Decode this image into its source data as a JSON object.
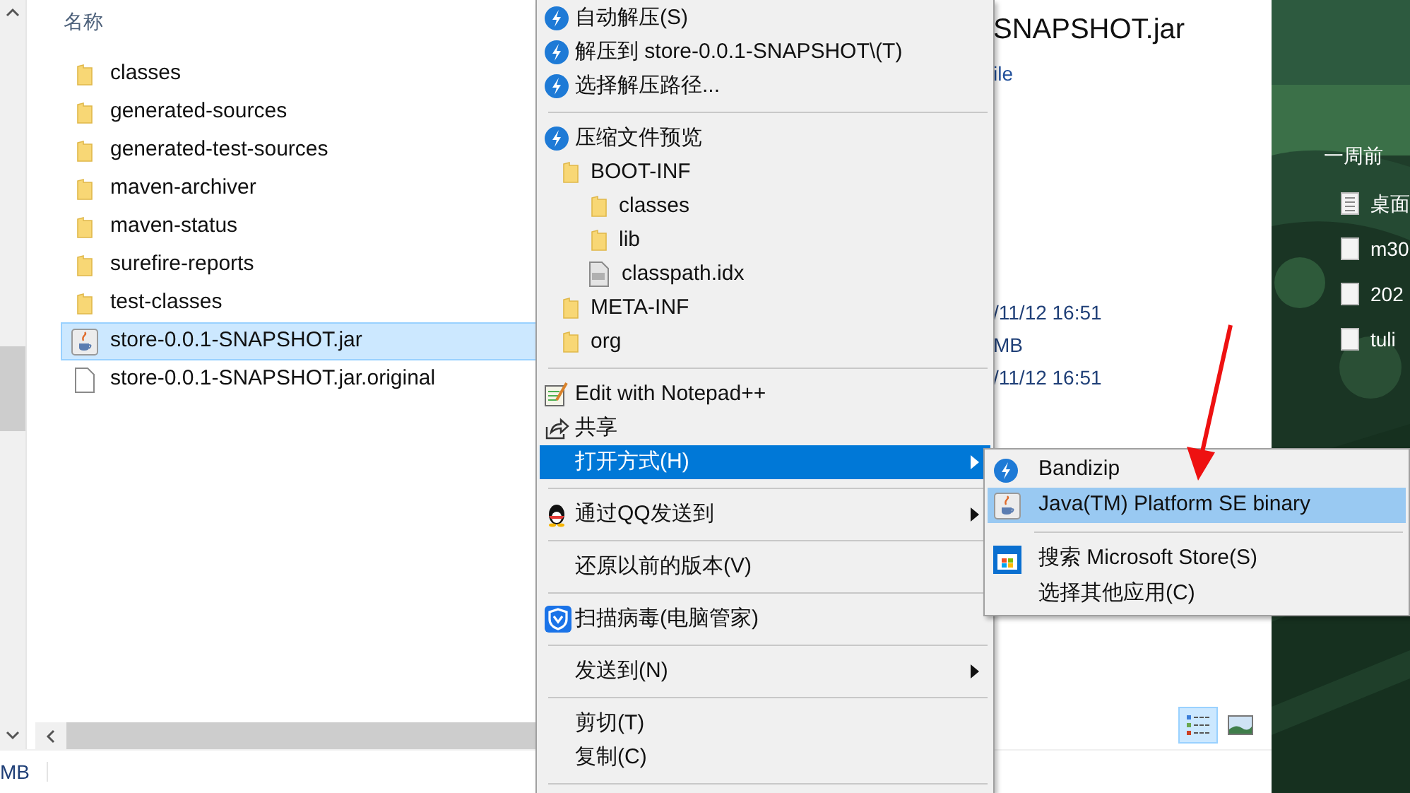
{
  "explorer": {
    "column_header": "名称",
    "files": [
      {
        "name": "classes",
        "kind": "folder",
        "selected": false
      },
      {
        "name": "generated-sources",
        "kind": "folder",
        "selected": false
      },
      {
        "name": "generated-test-sources",
        "kind": "folder",
        "selected": false
      },
      {
        "name": "maven-archiver",
        "kind": "folder",
        "selected": false
      },
      {
        "name": "maven-status",
        "kind": "folder",
        "selected": false
      },
      {
        "name": "surefire-reports",
        "kind": "folder",
        "selected": false
      },
      {
        "name": "test-classes",
        "kind": "folder",
        "selected": false
      },
      {
        "name": "store-0.0.1-SNAPSHOT.jar",
        "kind": "jar",
        "selected": true
      },
      {
        "name": "store-0.0.1-SNAPSHOT.jar.original",
        "kind": "file",
        "selected": false
      }
    ],
    "details": {
      "title": "SNAPSHOT.jar",
      "type": "ile",
      "fields": [
        "/11/12 16:51",
        "MB",
        "/11/12 16:51"
      ]
    },
    "view_buttons": [
      {
        "kind": "details",
        "selected": true
      },
      {
        "kind": "preview",
        "selected": false
      }
    ],
    "status_bar": {
      "size": "MB"
    }
  },
  "context_menu": {
    "sections": [
      {
        "items": [
          {
            "label": "自动解压(S)",
            "kind": "bandizip",
            "has_submenu": false,
            "selected": false
          },
          {
            "label": "解压到 store-0.0.1-SNAPSHOT\\(T)",
            "kind": "bandizip",
            "has_submenu": false,
            "selected": false
          },
          {
            "label": "选择解压路径...",
            "kind": "bandizip",
            "has_submenu": false,
            "selected": false
          }
        ]
      },
      {
        "items": [
          {
            "label": "压缩文件预览",
            "kind": "bandizip",
            "has_submenu": false,
            "selected": false
          }
        ],
        "tree": [
          {
            "label": "BOOT-INF",
            "kind": "folder",
            "children": [
              {
                "label": "classes",
                "kind": "folder"
              },
              {
                "label": "lib",
                "kind": "folder"
              },
              {
                "label": "classpath.idx",
                "kind": "file"
              }
            ]
          },
          {
            "label": "META-INF",
            "kind": "folder"
          },
          {
            "label": "org",
            "kind": "folder"
          }
        ]
      },
      {
        "items": [
          {
            "label": "Edit with Notepad++",
            "kind": "notepad",
            "has_submenu": false,
            "selected": false
          },
          {
            "label": "共享",
            "kind": "share",
            "has_submenu": false,
            "selected": false
          },
          {
            "label": "打开方式(H)",
            "kind": "plain",
            "has_submenu": true,
            "selected": true
          }
        ]
      },
      {
        "items": [
          {
            "label": "通过QQ发送到",
            "kind": "qq",
            "has_submenu": true,
            "selected": false
          }
        ]
      },
      {
        "items": [
          {
            "label": "还原以前的版本(V)",
            "kind": "plain",
            "has_submenu": false,
            "selected": false
          }
        ]
      },
      {
        "items": [
          {
            "label": "扫描病毒(电脑管家)",
            "kind": "shield",
            "has_submenu": false,
            "selected": false
          }
        ]
      },
      {
        "items": [
          {
            "label": "发送到(N)",
            "kind": "plain",
            "has_submenu": true,
            "selected": false
          }
        ]
      },
      {
        "items": [
          {
            "label": "剪切(T)",
            "kind": "plain",
            "has_submenu": false,
            "selected": false
          },
          {
            "label": "复制(C)",
            "kind": "plain",
            "has_submenu": false,
            "selected": false
          }
        ]
      }
    ]
  },
  "submenu": {
    "sections": [
      {
        "items": [
          {
            "label": "Bandizip",
            "kind": "bandizip",
            "selected": false
          },
          {
            "label": "Java(TM) Platform SE binary",
            "kind": "java",
            "selected": true
          }
        ]
      },
      {
        "items": [
          {
            "label": "搜索 Microsoft Store(S)",
            "kind": "store",
            "selected": false
          },
          {
            "label": "选择其他应用(C)",
            "kind": "plain",
            "selected": false
          }
        ]
      }
    ]
  },
  "desktop": {
    "heading": "一周前",
    "files": [
      {
        "name": "桌面",
        "kind": "text"
      },
      {
        "name": "m30",
        "kind": "blank"
      },
      {
        "name": "202",
        "kind": "blank"
      },
      {
        "name": "tuli",
        "kind": "blank"
      }
    ]
  }
}
